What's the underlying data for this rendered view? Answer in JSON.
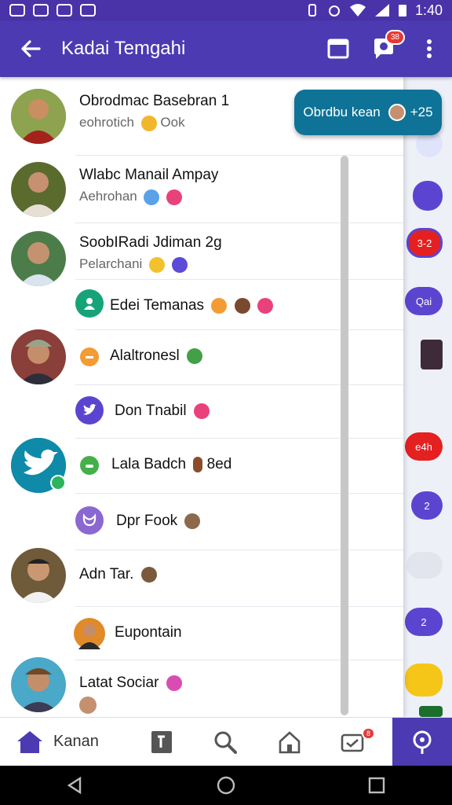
{
  "status_bar": {
    "time": "1:40",
    "left_icons": [
      "S1",
      "S2",
      "S3",
      "S4"
    ]
  },
  "app_bar": {
    "title": "Kadai Temgahi",
    "chat_badge": "38"
  },
  "bubble": {
    "text": "Obrdbu kean",
    "count": "+25"
  },
  "contacts": [
    {
      "name": "Obrodmac Basebran 1",
      "sub": "eohrotich",
      "sub_tail": "Ook"
    },
    {
      "name": "Wlabc Manail Ampay",
      "sub": "Aehrohan"
    },
    {
      "name": "SoobIRadi Jdiman 2g",
      "sub": "Pelarchani"
    },
    {
      "name": "Edei Temanas"
    },
    {
      "name": "Alaltronesl"
    },
    {
      "name": "Don Tnabil"
    },
    {
      "name": "Lala Badch",
      "name_tail": "8ed"
    },
    {
      "name": "Dpr Fook"
    },
    {
      "name": "Adn Tar."
    },
    {
      "name": "Eupontain"
    },
    {
      "name": "Latat Sociar"
    }
  ],
  "right_strip": {
    "badge1": "3-2",
    "badge2": "Qai",
    "badge3": "e4h",
    "badge4": "2",
    "badge5": "2"
  },
  "bottom_nav": {
    "home_label": "Kanan",
    "badge": "8"
  },
  "colors": {
    "primary": "#4c3ab2",
    "bubble": "#0e7396",
    "twitter": "#1d9bf0"
  }
}
